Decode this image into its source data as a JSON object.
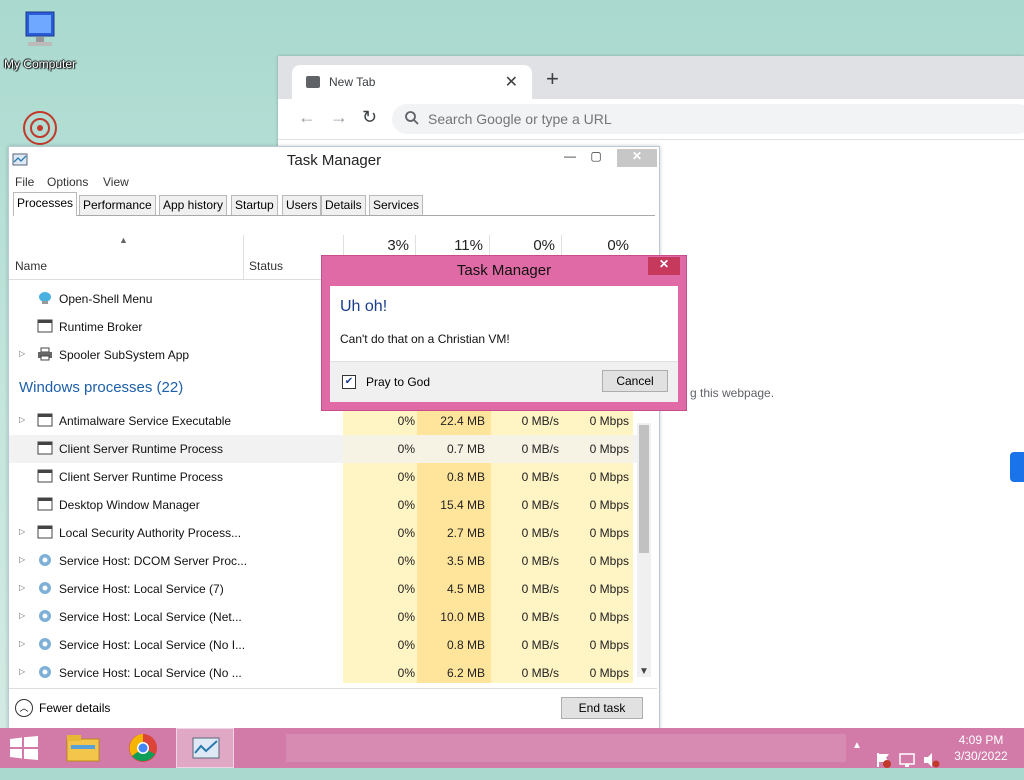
{
  "desktop": {
    "icons": [
      {
        "label": "My Computer",
        "icon": "computer-icon"
      },
      {
        "label": "",
        "icon": "mandala-icon"
      }
    ]
  },
  "browser": {
    "tab_title": "New Tab",
    "omnibox_placeholder": "Search Google or type a URL",
    "page_text_fragment": "g this webpage."
  },
  "task_manager": {
    "title": "Task Manager",
    "menu": [
      "File",
      "Options",
      "View"
    ],
    "tabs": [
      "Processes",
      "Performance",
      "App history",
      "Startup",
      "Users",
      "Details",
      "Services"
    ],
    "active_tab": "Processes",
    "columns": {
      "name": "Name",
      "status": "Status",
      "cpu": "3%",
      "memory": "11%",
      "disk": "0%",
      "network": "0%"
    },
    "apps": [
      {
        "name": "Open-Shell Menu",
        "expandable": false,
        "icon": "shell-icon"
      },
      {
        "name": "Runtime Broker",
        "expandable": false,
        "icon": "window-icon"
      },
      {
        "name": "Spooler SubSystem App",
        "expandable": true,
        "icon": "printer-icon"
      }
    ],
    "group_header": "Windows processes (22)",
    "processes": [
      {
        "name": "Antimalware Service Executable",
        "expandable": true,
        "icon": "window-icon",
        "cpu": "0%",
        "mem": "22.4 MB",
        "disk": "0 MB/s",
        "net": "0 Mbps",
        "selected": false
      },
      {
        "name": "Client Server Runtime Process",
        "expandable": false,
        "icon": "window-icon",
        "cpu": "0%",
        "mem": "0.7 MB",
        "disk": "0 MB/s",
        "net": "0 Mbps",
        "selected": true
      },
      {
        "name": "Client Server Runtime Process",
        "expandable": false,
        "icon": "window-icon",
        "cpu": "0%",
        "mem": "0.8 MB",
        "disk": "0 MB/s",
        "net": "0 Mbps",
        "selected": false
      },
      {
        "name": "Desktop Window Manager",
        "expandable": false,
        "icon": "window-icon",
        "cpu": "0%",
        "mem": "15.4 MB",
        "disk": "0 MB/s",
        "net": "0 Mbps",
        "selected": false
      },
      {
        "name": "Local Security Authority Process...",
        "expandable": true,
        "icon": "window-icon",
        "cpu": "0%",
        "mem": "2.7 MB",
        "disk": "0 MB/s",
        "net": "0 Mbps",
        "selected": false
      },
      {
        "name": "Service Host: DCOM Server Proc...",
        "expandable": true,
        "icon": "gear-icon",
        "cpu": "0%",
        "mem": "3.5 MB",
        "disk": "0 MB/s",
        "net": "0 Mbps",
        "selected": false
      },
      {
        "name": "Service Host: Local Service (7)",
        "expandable": true,
        "icon": "gear-icon",
        "cpu": "0%",
        "mem": "4.5 MB",
        "disk": "0 MB/s",
        "net": "0 Mbps",
        "selected": false
      },
      {
        "name": "Service Host: Local Service (Net...",
        "expandable": true,
        "icon": "gear-icon",
        "cpu": "0%",
        "mem": "10.0 MB",
        "disk": "0 MB/s",
        "net": "0 Mbps",
        "selected": false
      },
      {
        "name": "Service Host: Local Service (No I...",
        "expandable": true,
        "icon": "gear-icon",
        "cpu": "0%",
        "mem": "0.8 MB",
        "disk": "0 MB/s",
        "net": "0 Mbps",
        "selected": false
      },
      {
        "name": "Service Host: Local Service (No ...",
        "expandable": true,
        "icon": "gear-icon",
        "cpu": "0%",
        "mem": "6.2 MB",
        "disk": "0 MB/s",
        "net": "0 Mbps",
        "selected": false
      }
    ],
    "fewer_details": "Fewer details",
    "end_task": "End task"
  },
  "dialog": {
    "title": "Task Manager",
    "heading": "Uh oh!",
    "message": "Can't do that on a Christian VM!",
    "checkbox_label": "Pray to God",
    "checkbox_checked": true,
    "cancel": "Cancel"
  },
  "taskbar": {
    "time": "4:09 PM",
    "date": "3/30/2022",
    "pinned": [
      "file-explorer-icon",
      "chrome-icon",
      "task-manager-icon"
    ],
    "colors": {
      "taskbar": "#d27aa8",
      "dialog_frame": "#e06aa5"
    }
  }
}
